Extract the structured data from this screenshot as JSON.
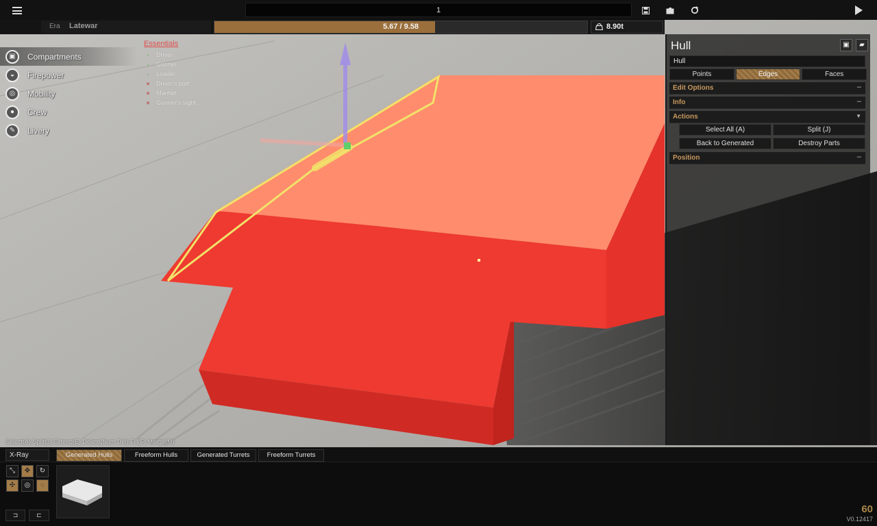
{
  "topbar": {
    "project_value": "1",
    "save_icon": "floppy-icon",
    "load_icon": "folder-icon",
    "reset_icon": "refresh-icon",
    "play_icon": "play-icon"
  },
  "status": {
    "era_label": "Era",
    "era_value": "Latewar",
    "weight_text": "5.67 / 9.58",
    "weight_fraction": 0.592,
    "tonnage": "8.90t"
  },
  "categories": [
    {
      "label": "Compartments",
      "icon": "cube-icon"
    },
    {
      "label": "Firepower",
      "icon": "cannon-icon"
    },
    {
      "label": "Mobility",
      "icon": "wheel-icon"
    },
    {
      "label": "Crew",
      "icon": "person-icon"
    },
    {
      "label": "Livery",
      "icon": "brush-icon"
    }
  ],
  "essentials": {
    "title": "Essentials",
    "items": [
      {
        "label": "Driver",
        "mark": "-",
        "ok": true
      },
      {
        "label": "Gunner",
        "mark": "-",
        "ok": true
      },
      {
        "label": "Loader",
        "mark": "-",
        "ok": true
      },
      {
        "label": "Driver's port",
        "mark": "×",
        "ok": false
      },
      {
        "label": "Mantlet",
        "mark": "×",
        "ok": false
      },
      {
        "label": "Gunner's sight",
        "mark": "×",
        "ok": false
      }
    ]
  },
  "hint": "Select(A) Split(J) Extend(E) Delete(Num Del) Fill(F) Merge(M)",
  "panel": {
    "title": "Hull",
    "name_value": "Hull",
    "tabs": [
      "Points",
      "Edges",
      "Faces"
    ],
    "sections": {
      "edit_options": "Edit Options",
      "info": "Info",
      "actions": "Actions",
      "position": "Position"
    },
    "toggles": {
      "collapsed": "–",
      "expanded": "▼"
    },
    "actions": [
      "Select All (A)",
      "Split (J)",
      "Back to Generated",
      "Destroy Parts"
    ]
  },
  "bottom": {
    "xray": "X-Ray",
    "tabs": [
      "Generated Hulls",
      "Freeform Hulls",
      "Generated Turrets",
      "Freeform Turrets"
    ],
    "undo": "⊐",
    "redo": "⊏"
  },
  "fps": "60",
  "version": "V0.12417",
  "colors": {
    "accent": "#a37c48",
    "section_text": "#c7995f",
    "hull_top": "#ff8a6a",
    "hull_side": "#e8352d",
    "selection_edge": "#f2e06a"
  }
}
